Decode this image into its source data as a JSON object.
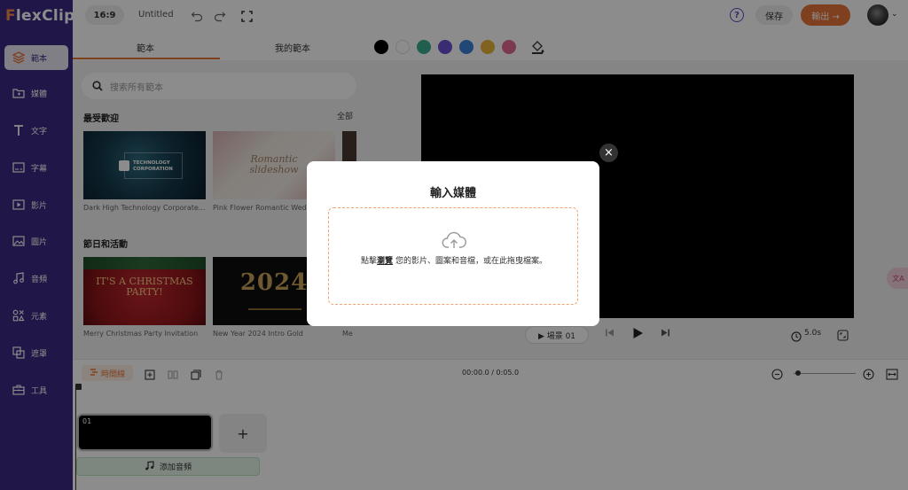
{
  "app": {
    "logo_prefix": "F",
    "logo_rest": "lexClip"
  },
  "sidebar": {
    "items": [
      {
        "label": "範本",
        "icon": "layers-icon"
      },
      {
        "label": "媒體",
        "icon": "folder-icon"
      },
      {
        "label": "文字",
        "icon": "text-icon"
      },
      {
        "label": "字幕",
        "icon": "subtitle-icon"
      },
      {
        "label": "影片",
        "icon": "video-icon"
      },
      {
        "label": "圖片",
        "icon": "image-icon"
      },
      {
        "label": "音頻",
        "icon": "music-icon"
      },
      {
        "label": "元素",
        "icon": "elements-icon"
      },
      {
        "label": "遮罩",
        "icon": "mask-icon"
      },
      {
        "label": "工具",
        "icon": "toolbox-icon"
      }
    ]
  },
  "topbar": {
    "ratio": "16:9",
    "title": "Untitled",
    "save": "保存",
    "export": "輸出 →"
  },
  "templates": {
    "tabs": [
      "範本",
      "我的範本"
    ],
    "search_placeholder": "搜索所有範本",
    "sections": [
      {
        "title": "最受歡迎",
        "all_label": "全部",
        "items": [
          {
            "caption": "Dark High Technology Corporate...",
            "thumb_text": "TECHNOLOGY CORPORATION"
          },
          {
            "caption": "Pink Flower Romantic Wedd...",
            "thumb_text": "Romantic slideshow"
          }
        ]
      },
      {
        "title": "節日和活動",
        "items": [
          {
            "caption": "Merry Christmas Party Invitation",
            "thumb_text": "IT'S A CHRISTMAS PARTY!"
          },
          {
            "caption": "New Year 2024 Intro Gold",
            "thumb_text": "2024"
          },
          {
            "caption": "Me"
          }
        ]
      }
    ]
  },
  "palette": {
    "colors": [
      "#000000",
      "#ffffff",
      "#3bab8e",
      "#6a4fd0",
      "#3b82d6",
      "#e8b53a",
      "#e06b93"
    ]
  },
  "preview": {
    "scene_label": "▶ 場景 01",
    "duration": "5.0s",
    "translate_label": "文A"
  },
  "timeline": {
    "label": "時間線",
    "time": "00:00.0 / 0:05.0",
    "clip_number": "01",
    "add_audio": "添加音頻"
  },
  "modal": {
    "title": "輸入媒體",
    "text_before": "點擊",
    "link": "瀏覽",
    "text_after": "您的影片、圖案和音檔，或在此拖曳檔案。",
    "close": "×"
  }
}
